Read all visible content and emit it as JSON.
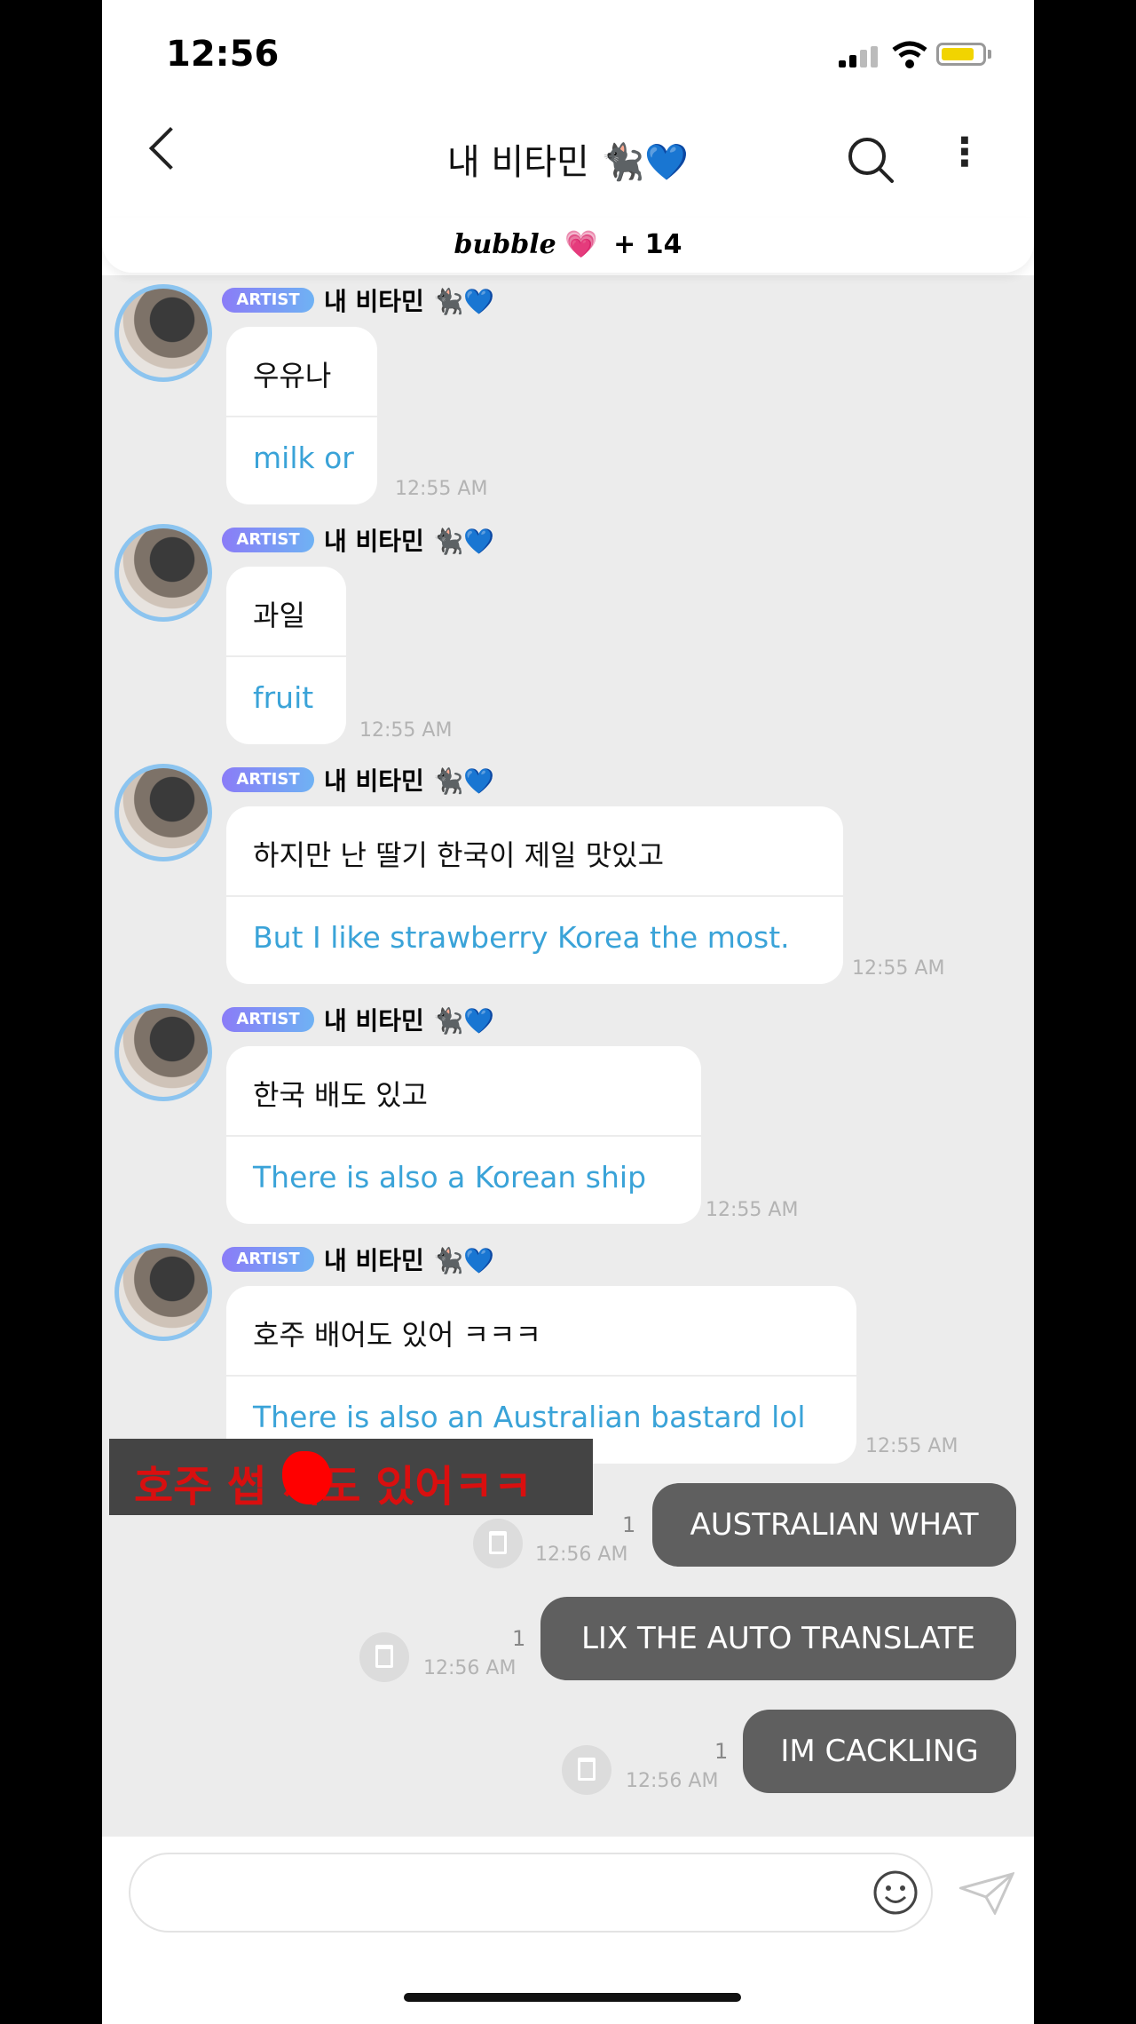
{
  "status_bar": {
    "time": "12:56"
  },
  "header": {
    "title": "내 비타민 🐈‍⬛💙",
    "bubble_word": "bubble",
    "heart": "💗",
    "count": "+ 14"
  },
  "artist_label": "ARTIST",
  "messages": [
    {
      "sender": "내 비타민 🐈‍⬛💙",
      "korean": "우유나",
      "english": "milk or",
      "time": "12:55 AM"
    },
    {
      "sender": "내 비타민 🐈‍⬛💙",
      "korean": "과일",
      "english": "fruit",
      "time": "12:55 AM"
    },
    {
      "sender": "내 비타민 🐈‍⬛💙",
      "korean": "하지만 난 딸기 한국이 제일 맛있고",
      "english": "But I like strawberry Korea the most.",
      "time": "12:55 AM"
    },
    {
      "sender": "내 비타민 🐈‍⬛💙",
      "korean": "한국 배도 있고",
      "english": "There is also a Korean ship",
      "time": "12:55 AM"
    },
    {
      "sender": "내 비타민 🐈‍⬛💙",
      "korean": "호주 배어도 있어 ㅋㅋㅋ",
      "english": "There is also an Australian bastard lol",
      "time": "12:55 AM"
    }
  ],
  "overlay_caption": {
    "before": "호주 썹",
    "after": "끼도 있어ㅋㅋ"
  },
  "my_messages": [
    {
      "text": "AUSTRALIAN WHAT",
      "unread": "1",
      "time": "12:56 AM"
    },
    {
      "text": "LIX THE AUTO TRANSLATE",
      "unread": "1",
      "time": "12:56 AM"
    },
    {
      "text": "IM CACKLING",
      "unread": "1",
      "time": "12:56 AM"
    }
  ],
  "composer": {
    "placeholder": ""
  },
  "colors": {
    "translation": "#3aa3d8",
    "my_bubble": "#5f5f5f",
    "badge_start": "#8a7cf7",
    "badge_end": "#6fb2f4",
    "caption_red": "#d90f0f"
  },
  "icons": [
    "back-icon",
    "search-icon",
    "more-icon",
    "trash-icon",
    "emoji-icon",
    "send-icon",
    "wifi-icon",
    "battery-icon",
    "signal-icon"
  ]
}
